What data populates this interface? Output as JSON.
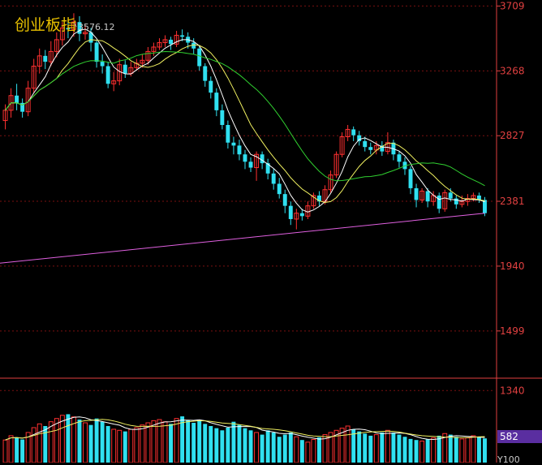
{
  "title": "创业板指",
  "high_label": "3576.12",
  "price_ticks": [
    "3709",
    "3268",
    "2827",
    "2381",
    "1940",
    "1499"
  ],
  "price_tick_values": [
    3709,
    3268,
    2827,
    2381,
    1940,
    1499
  ],
  "volume_ticks": [
    "1340",
    "582"
  ],
  "volume_bottom_label": "Y100",
  "colors": {
    "up": "#ff3030",
    "down": "#30e0f0",
    "ma5": "#ffffff",
    "ma10": "#f0f060",
    "ma20": "#30d030",
    "ma250": "#e060e0",
    "grid": "#7a1010",
    "axis": "#e04040",
    "title": "#e8c000"
  },
  "chart_data": {
    "type": "candlestick",
    "title": "创业板指",
    "ylim": [
      1200,
      3750
    ],
    "candles": [
      [
        2930,
        3000,
        2870,
        3040
      ],
      [
        3000,
        3100,
        2950,
        3150
      ],
      [
        3100,
        3050,
        3000,
        3180
      ],
      [
        3050,
        2990,
        2950,
        3080
      ],
      [
        2990,
        3150,
        2960,
        3200
      ],
      [
        3150,
        3300,
        3120,
        3350
      ],
      [
        3300,
        3370,
        3250,
        3420
      ],
      [
        3370,
        3330,
        3280,
        3410
      ],
      [
        3330,
        3400,
        3300,
        3470
      ],
      [
        3400,
        3480,
        3360,
        3530
      ],
      [
        3480,
        3560,
        3440,
        3600
      ],
      [
        3560,
        3550,
        3490,
        3620
      ],
      [
        3550,
        3600,
        3500,
        3660
      ],
      [
        3600,
        3520,
        3470,
        3640
      ],
      [
        3520,
        3530,
        3480,
        3580
      ],
      [
        3530,
        3460,
        3400,
        3560
      ],
      [
        3460,
        3330,
        3290,
        3480
      ],
      [
        3330,
        3300,
        3250,
        3380
      ],
      [
        3300,
        3180,
        3150,
        3330
      ],
      [
        3180,
        3200,
        3130,
        3260
      ],
      [
        3200,
        3310,
        3170,
        3350
      ],
      [
        3310,
        3250,
        3220,
        3340
      ],
      [
        3250,
        3290,
        3230,
        3330
      ],
      [
        3290,
        3320,
        3270,
        3350
      ],
      [
        3320,
        3340,
        3290,
        3380
      ],
      [
        3340,
        3400,
        3310,
        3430
      ],
      [
        3400,
        3430,
        3370,
        3460
      ],
      [
        3430,
        3460,
        3410,
        3490
      ],
      [
        3460,
        3480,
        3430,
        3510
      ],
      [
        3480,
        3450,
        3410,
        3500
      ],
      [
        3450,
        3510,
        3430,
        3540
      ],
      [
        3510,
        3500,
        3470,
        3550
      ],
      [
        3500,
        3460,
        3420,
        3530
      ],
      [
        3460,
        3420,
        3380,
        3490
      ],
      [
        3420,
        3300,
        3270,
        3440
      ],
      [
        3300,
        3200,
        3160,
        3320
      ],
      [
        3200,
        3120,
        3080,
        3230
      ],
      [
        3120,
        3000,
        2960,
        3150
      ],
      [
        3000,
        2900,
        2870,
        3040
      ],
      [
        2900,
        2780,
        2740,
        2930
      ],
      [
        2780,
        2760,
        2700,
        2820
      ],
      [
        2760,
        2700,
        2660,
        2800
      ],
      [
        2700,
        2650,
        2600,
        2730
      ],
      [
        2650,
        2610,
        2580,
        2680
      ],
      [
        2610,
        2700,
        2520,
        2720
      ],
      [
        2700,
        2640,
        2600,
        2720
      ],
      [
        2640,
        2570,
        2530,
        2670
      ],
      [
        2570,
        2500,
        2460,
        2600
      ],
      [
        2500,
        2430,
        2400,
        2540
      ],
      [
        2430,
        2350,
        2300,
        2460
      ],
      [
        2350,
        2260,
        2220,
        2380
      ],
      [
        2260,
        2300,
        2190,
        2330
      ],
      [
        2300,
        2280,
        2250,
        2330
      ],
      [
        2280,
        2350,
        2260,
        2380
      ],
      [
        2350,
        2420,
        2330,
        2440
      ],
      [
        2420,
        2380,
        2350,
        2450
      ],
      [
        2380,
        2460,
        2360,
        2490
      ],
      [
        2460,
        2560,
        2440,
        2590
      ],
      [
        2560,
        2700,
        2540,
        2720
      ],
      [
        2700,
        2820,
        2680,
        2850
      ],
      [
        2820,
        2870,
        2790,
        2900
      ],
      [
        2870,
        2830,
        2790,
        2890
      ],
      [
        2830,
        2790,
        2760,
        2860
      ],
      [
        2790,
        2750,
        2720,
        2820
      ],
      [
        2750,
        2730,
        2700,
        2780
      ],
      [
        2730,
        2760,
        2700,
        2790
      ],
      [
        2760,
        2720,
        2690,
        2790
      ],
      [
        2720,
        2780,
        2700,
        2850
      ],
      [
        2780,
        2700,
        2660,
        2800
      ],
      [
        2700,
        2650,
        2610,
        2720
      ],
      [
        2650,
        2600,
        2560,
        2680
      ],
      [
        2600,
        2470,
        2430,
        2620
      ],
      [
        2470,
        2390,
        2340,
        2500
      ],
      [
        2390,
        2450,
        2370,
        2470
      ],
      [
        2450,
        2380,
        2340,
        2470
      ],
      [
        2380,
        2420,
        2350,
        2450
      ],
      [
        2420,
        2330,
        2300,
        2440
      ],
      [
        2330,
        2440,
        2310,
        2460
      ],
      [
        2440,
        2400,
        2380,
        2470
      ],
      [
        2400,
        2360,
        2330,
        2420
      ],
      [
        2360,
        2380,
        2340,
        2420
      ],
      [
        2380,
        2400,
        2350,
        2430
      ],
      [
        2400,
        2420,
        2380,
        2440
      ],
      [
        2420,
        2390,
        2370,
        2440
      ],
      [
        2390,
        2300,
        2280,
        2410
      ]
    ],
    "ma250_range": [
      1960,
      2300
    ],
    "volume_ylim": [
      0,
      1450
    ],
    "volume_values": [
      420,
      500,
      470,
      430,
      560,
      650,
      720,
      680,
      760,
      820,
      880,
      900,
      850,
      800,
      740,
      700,
      820,
      760,
      680,
      620,
      600,
      580,
      620,
      650,
      700,
      740,
      780,
      800,
      760,
      720,
      820,
      860,
      790,
      740,
      780,
      720,
      680,
      640,
      600,
      650,
      760,
      700,
      640,
      600,
      560,
      520,
      600,
      560,
      480,
      520,
      560,
      480,
      420,
      380,
      430,
      470,
      520,
      560,
      600,
      640,
      680,
      620,
      580,
      540,
      500,
      520,
      560,
      600,
      560,
      520,
      480,
      440,
      420,
      400,
      430,
      460,
      500,
      540,
      520,
      480,
      440,
      460,
      500,
      480,
      450
    ],
    "volume_up": [
      1,
      1,
      0,
      0,
      1,
      1,
      1,
      0,
      1,
      1,
      1,
      0,
      1,
      0,
      1,
      0,
      0,
      0,
      0,
      1,
      1,
      0,
      1,
      1,
      1,
      1,
      1,
      1,
      1,
      0,
      1,
      0,
      0,
      0,
      0,
      0,
      0,
      0,
      0,
      0,
      0,
      0,
      0,
      0,
      1,
      0,
      0,
      0,
      0,
      0,
      0,
      1,
      0,
      1,
      1,
      0,
      1,
      1,
      1,
      1,
      1,
      0,
      0,
      0,
      0,
      1,
      0,
      1,
      0,
      0,
      0,
      0,
      0,
      1,
      0,
      1,
      0,
      1,
      0,
      0,
      1,
      1,
      1,
      0,
      0
    ]
  }
}
